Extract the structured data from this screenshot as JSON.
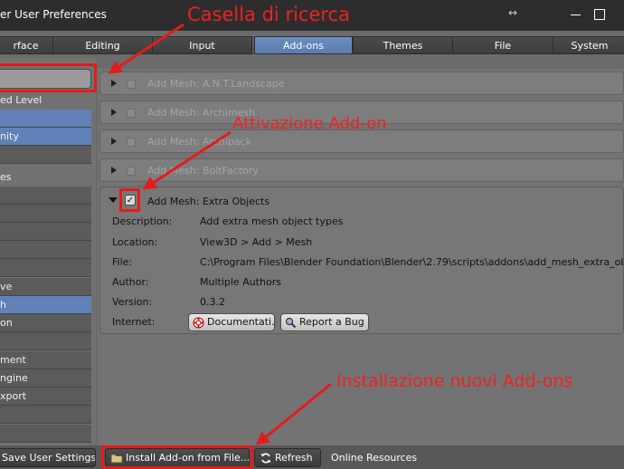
{
  "window": {
    "title": "er User Preferences",
    "resize_glyph": "↔"
  },
  "tabs": [
    {
      "label": "rface",
      "active": false
    },
    {
      "label": "Editing",
      "active": false
    },
    {
      "label": "Input",
      "active": false
    },
    {
      "label": "Add-ons",
      "active": true
    },
    {
      "label": "Themes",
      "active": false
    },
    {
      "label": "File",
      "active": false
    },
    {
      "label": "System",
      "active": false
    }
  ],
  "sidebar": {
    "support_label": "ed Level",
    "support_items": [
      "",
      "nity",
      ""
    ],
    "categories_label": "es",
    "category_items": [
      "",
      "",
      "",
      "",
      "",
      "ve",
      "h",
      "on",
      "",
      "ment",
      "ngine",
      "xport",
      "",
      ""
    ]
  },
  "addons": {
    "collapsed": [
      "Add Mesh: A.N.T.Landscape",
      "Add Mesh: Archimesh",
      "Add Mesh: Archipack",
      "Add Mesh: BoltFactory"
    ],
    "expanded": {
      "name": "Add Mesh: Extra Objects",
      "fields": [
        {
          "label": "Description:",
          "value": "Add extra mesh object types"
        },
        {
          "label": "Location:",
          "value": "View3D > Add > Mesh"
        },
        {
          "label": "File:",
          "value": "C:\\Program Files\\Blender Foundation\\Blender\\2.79\\scripts\\addons\\add_mesh_extra_objects\\__init__.py"
        },
        {
          "label": "Author:",
          "value": "Multiple Authors"
        },
        {
          "label": "Version:",
          "value": "0.3.2"
        },
        {
          "label": "Internet:",
          "value": ""
        }
      ],
      "doc_button": "Documentati...",
      "bug_button": "Report a Bug"
    }
  },
  "bottom": {
    "save": "Save User Settings",
    "install": "Install Add-on from File...",
    "refresh": "Refresh",
    "online": "Online Resources"
  },
  "annotations": {
    "search": "Casella di ricerca",
    "activation": "Attivazione Add-on",
    "install": "Installazione nuovi Add-ons"
  },
  "colors": {
    "accent": "#5f80b6",
    "annotation": "#e41b1b"
  }
}
